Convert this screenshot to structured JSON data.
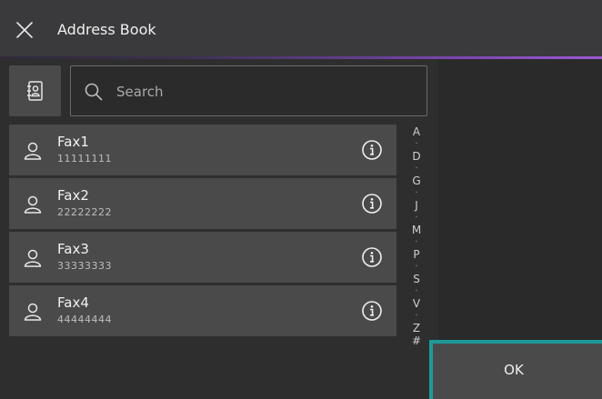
{
  "header": {
    "title": "Address Book",
    "close_icon": "close-icon"
  },
  "toolbar": {
    "contacts_icon": "address-book-icon",
    "search": {
      "placeholder": "Search",
      "value": "",
      "icon": "search-icon"
    }
  },
  "contacts": [
    {
      "name": "Fax1",
      "number": "11111111",
      "icon": "user-icon",
      "info_icon": "info-icon"
    },
    {
      "name": "Fax2",
      "number": "22222222",
      "icon": "user-icon",
      "info_icon": "info-icon"
    },
    {
      "name": "Fax3",
      "number": "33333333",
      "icon": "user-icon",
      "info_icon": "info-icon"
    },
    {
      "name": "Fax4",
      "number": "44444444",
      "icon": "user-icon",
      "info_icon": "info-icon"
    }
  ],
  "alpha_index": {
    "letters": [
      "A",
      "D",
      "G",
      "J",
      "M",
      "P",
      "S",
      "V",
      "Z",
      "#"
    ],
    "separator": "·"
  },
  "footer": {
    "ok_label": "OK"
  },
  "colors": {
    "accent": "#9b59d0",
    "focus": "#1e9a9a",
    "surface": "#4a4a4b",
    "background": "#2b2b2b"
  }
}
